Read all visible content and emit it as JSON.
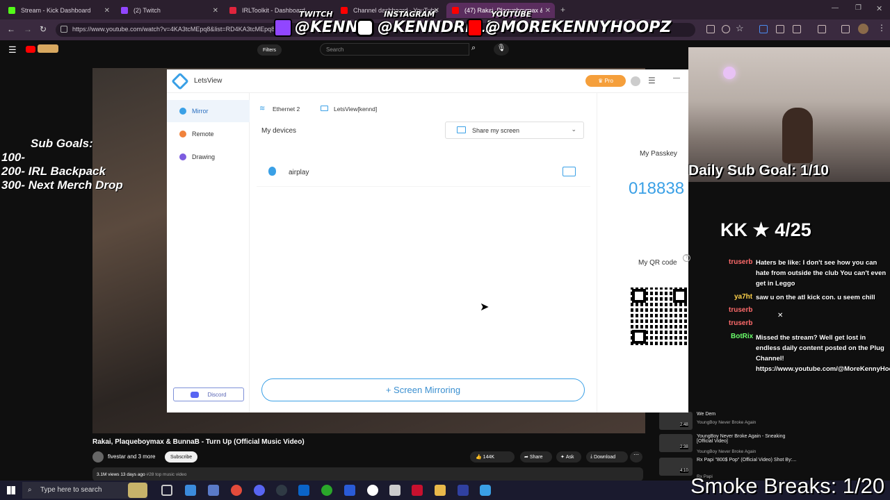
{
  "browser": {
    "tabs": [
      {
        "title": "Stream - Kick Dashboard",
        "color": "#53fc18"
      },
      {
        "title": "(2) Twitch",
        "color": "#9146ff"
      },
      {
        "title": "IRLToolkit - Dashboard",
        "color": "#e0243c"
      },
      {
        "title": "Channel dashboard - YouTube",
        "color": "#ff0000"
      },
      {
        "title": "(47) Rakai, Plaqueboymax & Bu",
        "color": "#ff0000"
      }
    ],
    "url": "https://www.youtube.com/watch?v=4KA3tcMEpq8&list=RD4KA3tcMEpq8"
  },
  "overlay": {
    "twitch_label": "TWITCH",
    "twitch_handle": "@KENNY",
    "instagram_label": "INSTAGRAM",
    "instagram_handle": "@KENNDRELL",
    "youtube_label": "YOUTUBE",
    "youtube_handle": "@MOREKENNYHOOPZ",
    "sub_goals_title": "Sub Goals:",
    "sub_goals": [
      "100-",
      "200- IRL Backpack",
      "300- Next Merch Drop"
    ],
    "daily_sub_goal": "Daily Sub Goal: 1/10",
    "kk_counter": "KK ★ 4/25",
    "smoke_breaks": "Smoke Breaks: 1/20"
  },
  "youtube": {
    "filters_label": "Filters",
    "search_placeholder": "Search",
    "video_title": "Rakai, Plaqueboymax & BunnaB - Turn Up (Official Music Video)",
    "channel": "fivestar and 3 more",
    "subscribe": "Subscribe",
    "likes": "144K",
    "share": "Share",
    "ask": "Ask",
    "download": "Download",
    "views_line": "3.1M views  13 days ago",
    "hashtag": "#28 top music video",
    "recommended": [
      {
        "title": "We Dem",
        "sub": "YoungBoy Never Broke Again",
        "duration": "2:48"
      },
      {
        "title": "YoungBoy Never Broke Again - Sneaking [Official Video]",
        "sub": "YoungBoy Never Broke Again",
        "duration": "2:38"
      },
      {
        "title": "Rx Papi \"800$ Pop\" (Official Video) Shot By:...",
        "sub": "Rx Papi",
        "duration": "4:10"
      }
    ]
  },
  "letsview": {
    "app_name": "LetsView",
    "pro_label": "Pro",
    "sidebar": [
      {
        "label": "Mirror",
        "color": "#3aa0e6"
      },
      {
        "label": "Remote",
        "color": "#f0823c"
      },
      {
        "label": "Drawing",
        "color": "#7c5ce0"
      }
    ],
    "discord_label": "Discord",
    "network": "Ethernet 2",
    "pc_name": "LetsView[kennd]",
    "my_devices": "My devices",
    "share_screen": "Share my screen",
    "device": "airplay",
    "passkey_label": "My Passkey",
    "passkey": "018838",
    "qr_label": "My QR code",
    "mirroring_button": "+ Screen Mirroring"
  },
  "chat": [
    {
      "user": "truserb",
      "color": "#ff6b6b",
      "message": "Haters be like: I don't see how you can hate from outside the club You can't even get in Leggo"
    },
    {
      "user": "ya7ht",
      "color": "#ffd24a",
      "message": "saw u on the atl kick con. u seem chill"
    },
    {
      "user": "truserb",
      "color": "#ff6b6b",
      "message": ""
    },
    {
      "user": "truserb",
      "color": "#ff6b6b",
      "message": ""
    },
    {
      "user": "BotRix",
      "color": "#6bff6b",
      "message": "Missed the stream? Well get lost in endless daily content posted on the Plug Channel! https://www.youtube.com/@MoreKennyHoo"
    }
  ],
  "taskbar": {
    "search_placeholder": "Type here to search"
  }
}
